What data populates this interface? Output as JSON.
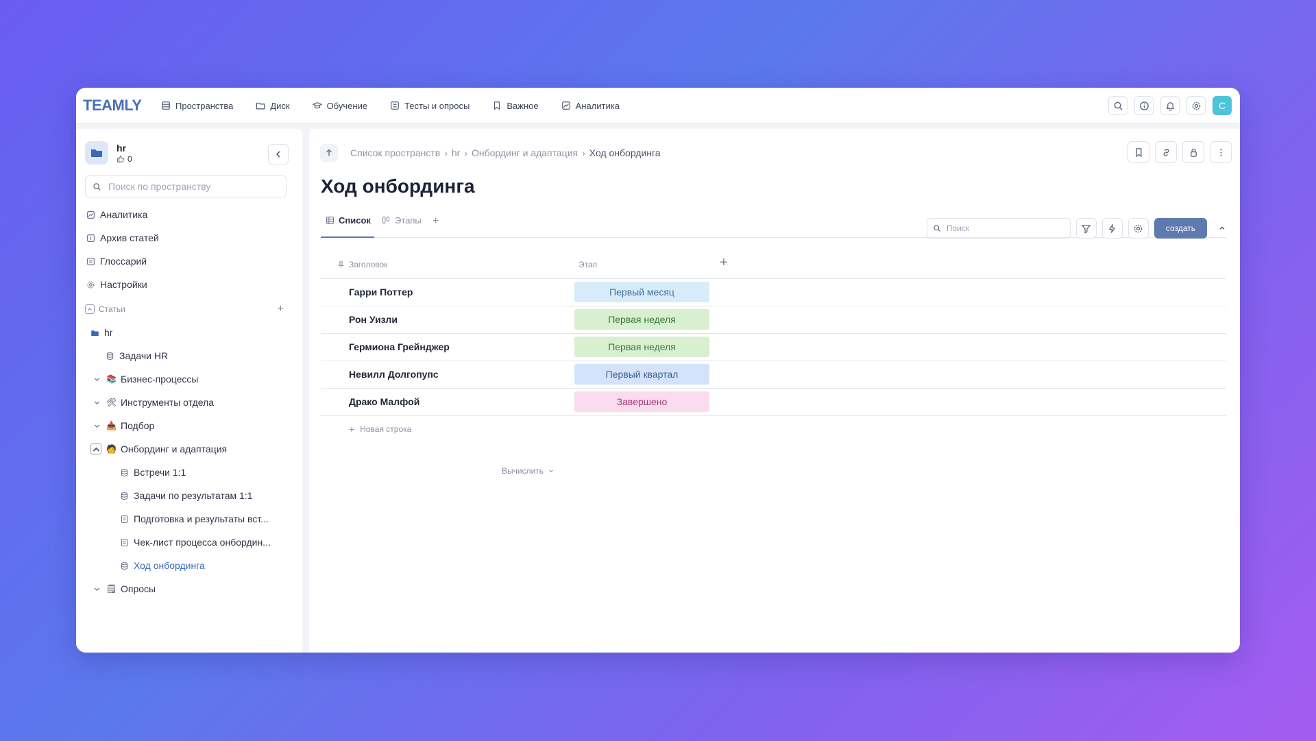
{
  "app": {
    "logo": "TEAMLY",
    "nav": [
      {
        "label": "Пространства",
        "icon": "spaces-icon"
      },
      {
        "label": "Диск",
        "icon": "folder-icon"
      },
      {
        "label": "Обучение",
        "icon": "graduation-cap-icon"
      },
      {
        "label": "Тесты и опросы",
        "icon": "test-icon"
      },
      {
        "label": "Важное",
        "icon": "bookmark-icon"
      },
      {
        "label": "Аналитика",
        "icon": "analytics-icon"
      }
    ],
    "avatar_letter": "C",
    "accent": "#4cc4d9"
  },
  "sidebar": {
    "space_name": "hr",
    "likes": "0",
    "search_placeholder": "Поиск по пространству",
    "links": [
      {
        "label": "Аналитика",
        "icon": "analytics-icon"
      },
      {
        "label": "Архив статей",
        "icon": "archive-icon"
      },
      {
        "label": "Глоссарий",
        "icon": "glossary-icon"
      },
      {
        "label": "Настройки",
        "icon": "settings-icon"
      }
    ],
    "section_label": "Статьи",
    "tree": [
      {
        "label": "hr",
        "icon": "folder-icon",
        "level": 0,
        "chevron": "none"
      },
      {
        "label": "Задачи HR",
        "icon": "database-icon",
        "level": 1,
        "chevron": "none"
      },
      {
        "label": "Бизнес-процессы",
        "icon": "books-icon",
        "emoji": "📚",
        "level": 1,
        "chevron": "down"
      },
      {
        "label": "Инструменты отдела",
        "icon": "tools-icon",
        "emoji": "🛠",
        "level": 1,
        "chevron": "down"
      },
      {
        "label": "Подбор",
        "icon": "inbox-icon",
        "emoji": "📥",
        "level": 1,
        "chevron": "down"
      },
      {
        "label": "Онбординг и адаптация",
        "icon": "person-icon",
        "emoji": "🧑",
        "level": 1,
        "chevron": "boxed-up"
      },
      {
        "label": "Встречи 1:1",
        "icon": "database-icon",
        "level": 2,
        "chevron": "none"
      },
      {
        "label": "Задачи по результатам 1:1",
        "icon": "database-icon",
        "level": 2,
        "chevron": "none"
      },
      {
        "label": "Подготовка и результаты вст...",
        "icon": "document-icon",
        "level": 2,
        "chevron": "none"
      },
      {
        "label": "Чек-лист процесса онбордин...",
        "icon": "document-icon",
        "level": 2,
        "chevron": "none"
      },
      {
        "label": "Ход онбординга",
        "icon": "database-icon",
        "level": 2,
        "chevron": "none",
        "active": true
      },
      {
        "label": "Опросы",
        "icon": "notepad-icon",
        "emoji": "🗒",
        "level": 1,
        "chevron": "down"
      }
    ]
  },
  "main": {
    "breadcrumb": [
      "Список пространств",
      "hr",
      "Онбординг и адаптация",
      "Ход онбординга"
    ],
    "title": "Ход онбординга",
    "tabs": [
      {
        "label": "Список",
        "icon": "table-icon",
        "active": true
      },
      {
        "label": "Этапы",
        "icon": "kanban-icon",
        "active": false
      }
    ],
    "toolbar": {
      "search_placeholder": "Поиск",
      "create_label": "создать"
    },
    "table": {
      "col_title": "Заголовок",
      "col_stage": "Этап",
      "rows": [
        {
          "name": "Гарри Поттер",
          "stage": "Первый месяц",
          "bg": "#d7ecf8",
          "fg": "#3d6f9a"
        },
        {
          "name": "Рон Уизли",
          "stage": "Первая неделя",
          "bg": "#d8f0d0",
          "fg": "#3f7a3a"
        },
        {
          "name": "Гермиона Грейнджер",
          "stage": "Первая неделя",
          "bg": "#d8f0d0",
          "fg": "#3f7a3a"
        },
        {
          "name": "Невилл Долгопупс",
          "stage": "Первый квартал",
          "bg": "#d4e3fa",
          "fg": "#3b5f95"
        },
        {
          "name": "Драко Малфой",
          "stage": "Завершено",
          "bg": "#fbdcef",
          "fg": "#a33a78"
        }
      ],
      "new_row": "Новая строка",
      "calc": "Вычислить"
    }
  }
}
